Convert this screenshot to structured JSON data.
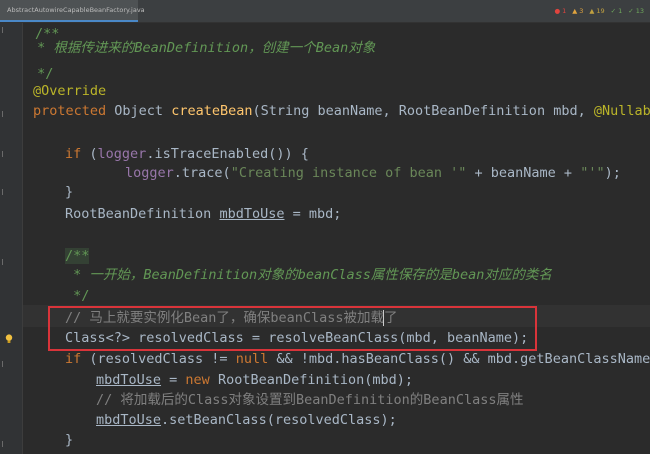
{
  "tab": {
    "title": "AbstractAutowireCapableBeanFactory.java",
    "icon": "java-class-icon"
  },
  "inspections": [
    {
      "icon": "error-icon",
      "count": "1",
      "color": "#e0443e"
    },
    {
      "icon": "warning-icon",
      "count": "3",
      "color": "#e0a33e"
    },
    {
      "icon": "weak-warning-icon",
      "count": "19",
      "color": "#c0a040"
    },
    {
      "icon": "typo-icon",
      "count": "1",
      "color": "#6fa85b"
    },
    {
      "icon": "check-icon",
      "count": "13",
      "color": "#6fa85b"
    }
  ],
  "code": {
    "l1_doc_open": "/**",
    "l2_a": " * 根据传进来的",
    "l2_b": "BeanDefinition",
    "l2_c": "，创建一个",
    "l2_d": "Bean",
    "l2_e": "对象",
    "l3": " */",
    "l4": "@Override",
    "l5_kw": "protected ",
    "l5_type": "Object ",
    "l5_fn": "createBean",
    "l5_params": "(String beanName, RootBeanDefinition mbd, ",
    "l5_ann": "@Nullable",
    "l7_kw": "if ",
    "l7_open": "(",
    "l7_field": "logger",
    "l7_rest": ".isTraceEnabled()) {",
    "l8_field": "logger",
    "l8_call": ".trace(",
    "l8_str": "\"Creating instance of bean '\"",
    "l8_mid": " + beanName + ",
    "l8_str2": "\"'\"",
    "l8_end": ");",
    "l9": "}",
    "l10_type": "RootBeanDefinition ",
    "l10_var": "mbdToUse",
    "l10_end": " = mbd;",
    "l12": "/**",
    "l13_a": " * 一开始，",
    "l13_b": "BeanDefinition",
    "l13_c": "对象的",
    "l13_d": "beanClass",
    "l13_e": "属性保存的是",
    "l13_f": "bean",
    "l13_g": "对应的类名",
    "l14": " */",
    "l15": "// 马上就要实例化Bean了，确保beanClass被加载了",
    "l16": "Class<?> resolvedClass = resolveBeanClass(mbd, beanName);",
    "l17_kw": "if ",
    "l17_a": "(resolvedClass != ",
    "l17_null": "null",
    "l17_b": " && !mbd.hasBeanClass() && mbd.getBeanClassName()",
    "l18_var": "mbdToUse",
    "l18_eq": " = ",
    "l18_kw": "new ",
    "l18_rest": "RootBeanDefinition(mbd);",
    "l19": "// 将加载后的Class对象设置到BeanDefinition的BeanClass属性",
    "l20_var": "mbdToUse",
    "l20_rest": ".setBeanClass(resolvedClass);",
    "l21": "}"
  }
}
